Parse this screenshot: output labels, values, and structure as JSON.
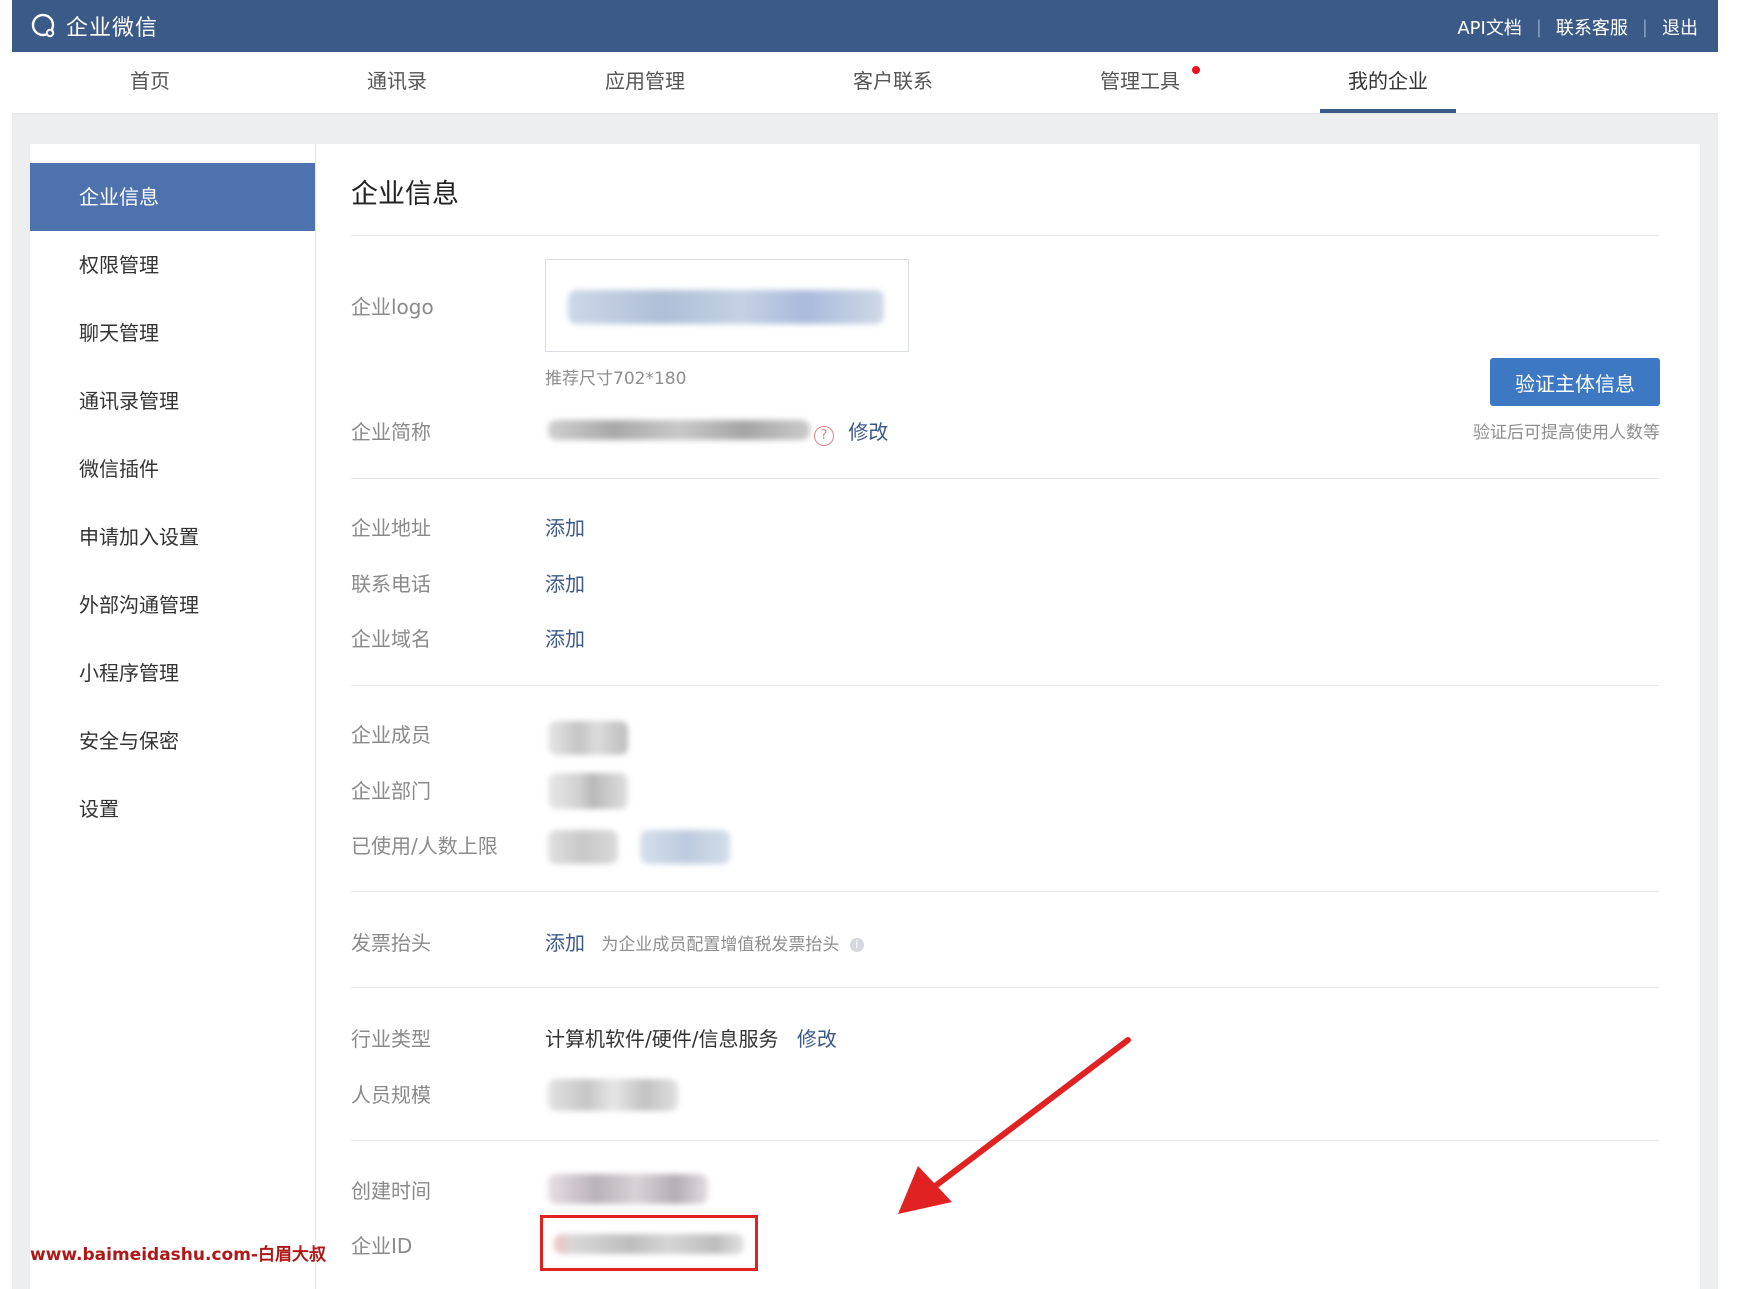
{
  "header": {
    "brand": "企业微信",
    "links": [
      "API文档",
      "联系客服",
      "退出"
    ]
  },
  "nav": {
    "items": [
      {
        "label": "首页"
      },
      {
        "label": "通讯录"
      },
      {
        "label": "应用管理"
      },
      {
        "label": "客户联系"
      },
      {
        "label": "管理工具"
      },
      {
        "label": "我的企业"
      }
    ],
    "active": "我的企业"
  },
  "sidebar": {
    "items": [
      {
        "label": "企业信息"
      },
      {
        "label": "权限管理"
      },
      {
        "label": "聊天管理"
      },
      {
        "label": "通讯录管理"
      },
      {
        "label": "微信插件"
      },
      {
        "label": "申请加入设置"
      },
      {
        "label": "外部沟通管理"
      },
      {
        "label": "小程序管理"
      },
      {
        "label": "安全与保密"
      },
      {
        "label": "设置"
      }
    ],
    "active": "企业信息"
  },
  "main": {
    "title": "企业信息",
    "logo": {
      "label": "企业logo",
      "hint": "推荐尺寸702*180"
    },
    "short_name": {
      "label": "企业简称",
      "edit": "修改"
    },
    "verify": {
      "button": "验证主体信息",
      "hint": "验证后可提高使用人数等"
    },
    "address": {
      "label": "企业地址",
      "action": "添加"
    },
    "phone": {
      "label": "联系电话",
      "action": "添加"
    },
    "domain": {
      "label": "企业域名",
      "action": "添加"
    },
    "members": {
      "label": "企业成员"
    },
    "departments": {
      "label": "企业部门"
    },
    "usage": {
      "label": "已使用/人数上限"
    },
    "invoice": {
      "label": "发票抬头",
      "action": "添加",
      "hint": "为企业成员配置增值税发票抬头"
    },
    "industry": {
      "label": "行业类型",
      "value": "计算机软件/硬件/信息服务",
      "edit": "修改"
    },
    "staff_size": {
      "label": "人员规模"
    },
    "created": {
      "label": "创建时间"
    },
    "corp_id": {
      "label": "企业ID"
    }
  },
  "watermark": "www.baimeidashu.com-白眉大叔",
  "colors": {
    "topbar": "#3c5a88",
    "sidebar_active": "#4e72ad",
    "primary_button": "#3d78c2",
    "highlight_box": "#e02222",
    "arrow": "#e02222"
  }
}
